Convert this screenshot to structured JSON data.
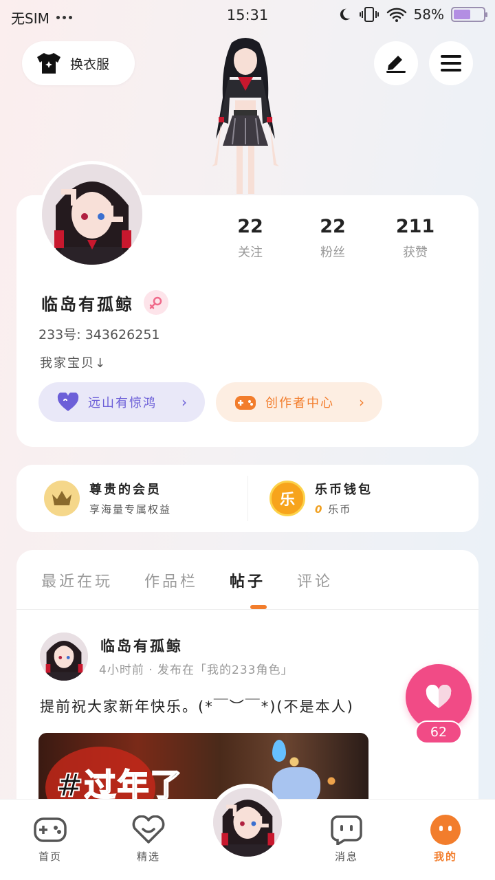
{
  "status_bar": {
    "carrier": "无SIM",
    "time": "15:31",
    "battery_percent": "58%",
    "battery_level": 0.58,
    "icons": [
      "more-dots-icon",
      "moon-icon",
      "vibrate-icon",
      "wifi-icon",
      "battery-icon"
    ]
  },
  "header": {
    "outfit_label": "换衣服",
    "outfit_icon": "tshirt-sparkle-icon",
    "edit_icon": "pencil-icon",
    "menu_icon": "hamburger-menu-icon"
  },
  "profile": {
    "stats": [
      {
        "value": "22",
        "label": "关注"
      },
      {
        "value": "22",
        "label": "粉丝"
      },
      {
        "value": "211",
        "label": "获赞"
      }
    ],
    "nickname": "临岛有孤鲸",
    "gender_icon": "female-icon",
    "uid": "233号: 343626251",
    "bio": "我家宝贝↓",
    "guild_label": "远山有惊鸿",
    "guild_icon": "heart-icon",
    "creator_label": "创作者中心",
    "creator_icon": "gamepad-plus-icon"
  },
  "wallet": {
    "vip_title": "尊贵的会员",
    "vip_subtitle": "享海量专属权益",
    "vip_icon": "crown-icon",
    "coins_title": "乐币钱包",
    "coins_amount": "0",
    "coins_unit": "乐币",
    "coins_icon_char": "乐"
  },
  "tabs": [
    {
      "label": "最近在玩",
      "active": false
    },
    {
      "label": "作品栏",
      "active": false
    },
    {
      "label": "帖子",
      "active": true
    },
    {
      "label": "评论",
      "active": false
    }
  ],
  "post": {
    "author": "临岛有孤鲸",
    "meta": "4小时前 · 发布在「我的233角色」",
    "text": "提前祝大家新年快乐。(*￣︶￣*)(不是本人)",
    "image_caption": "#过年了"
  },
  "like": {
    "count": "62",
    "icon": "heart-icon"
  },
  "bottom_nav": [
    {
      "label": "首页",
      "icon": "gamepad-icon"
    },
    {
      "label": "精选",
      "icon": "heart-badge-icon"
    },
    {
      "label": "消息",
      "icon": "chat-bubble-icon"
    },
    {
      "label": "我的",
      "icon": "face-icon"
    }
  ],
  "colors": {
    "accent": "#f27d2c",
    "like_pink": "#f14b86",
    "guild_purple": "#6c5fd8"
  }
}
